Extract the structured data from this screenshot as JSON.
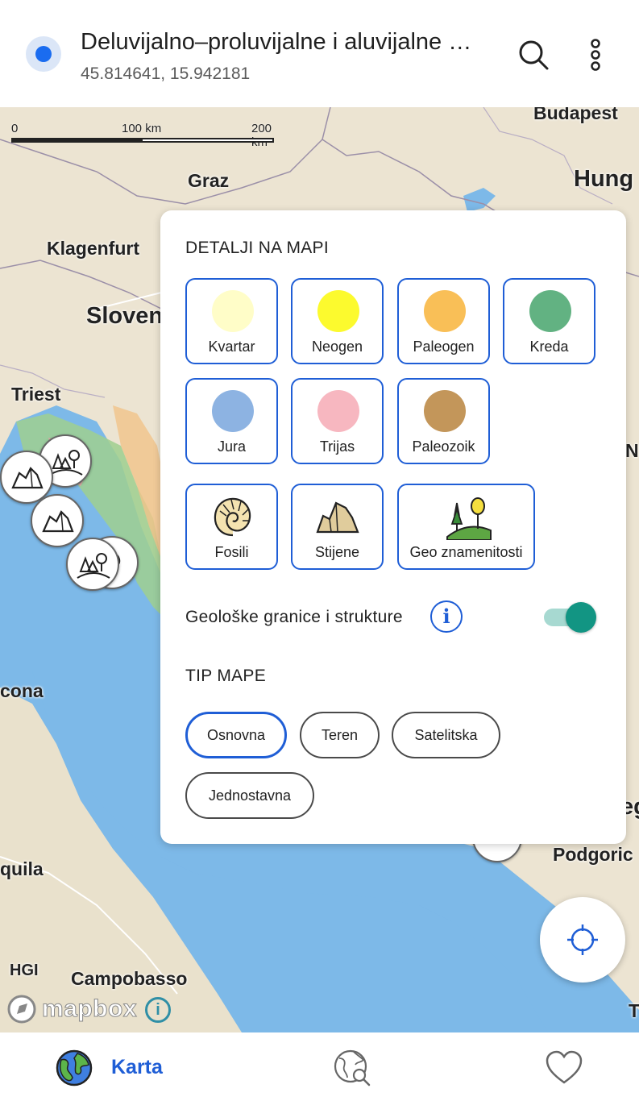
{
  "header": {
    "title": "Deluvijalno–proluvijalne i aluvijalne …",
    "coordinates": "45.814641, 15.942181",
    "icons": [
      "location-dot-icon",
      "search-icon",
      "more-vert-icon"
    ]
  },
  "map": {
    "scale": {
      "label_0": "0",
      "label_100": "100 km",
      "label_200": "200 km"
    },
    "cities": {
      "budapest": "Budapest",
      "hungary": "Hung",
      "graz": "Graz",
      "klagenfurt": "Klagenfurt",
      "slovenia": "Sloven",
      "triest": "Triest",
      "ancona": "cona",
      "aquila": "quila",
      "hgi": "HGI",
      "campobasso": "Campobasso",
      "podgorica": "Podgoric",
      "right_n": "N",
      "right_eg": "eg",
      "right_t": "T"
    },
    "attribution": {
      "logo": "mapbox",
      "info": "i"
    }
  },
  "panel": {
    "details_title": "DETALJI NA MAPI",
    "periods": [
      {
        "label": "Kvartar",
        "color": "#FFFDC8"
      },
      {
        "label": "Neogen",
        "color": "#FCFA2E"
      },
      {
        "label": "Paleogen",
        "color": "#F9BF57"
      },
      {
        "label": "Kreda",
        "color": "#62B282"
      },
      {
        "label": "Jura",
        "color": "#8DB3E2"
      },
      {
        "label": "Trijas",
        "color": "#F7B7C0"
      },
      {
        "label": "Paleozoik",
        "color": "#C3965A"
      }
    ],
    "features": [
      {
        "label": "Fosili",
        "icon": "fossil-icon"
      },
      {
        "label": "Stijene",
        "icon": "rock-icon"
      },
      {
        "label": "Geo znamenitosti",
        "icon": "landmark-icon"
      }
    ],
    "boundaries_label": "Geološke granice i strukture",
    "boundaries_info": "i",
    "boundaries_enabled": true,
    "map_type_title": "TIP MAPE",
    "map_types": [
      "Osnovna",
      "Teren",
      "Satelitska",
      "Jednostavna"
    ],
    "map_type_selected": "Osnovna"
  },
  "bottom_nav": {
    "karta_label": "Karta",
    "icons": [
      "globe-icon",
      "globe-search-icon",
      "heart-icon"
    ]
  },
  "colors": {
    "accent": "#1F5ED6",
    "toggle_on": "#129583",
    "sea": "#7DB9E8",
    "land": "#ECE4D2"
  }
}
